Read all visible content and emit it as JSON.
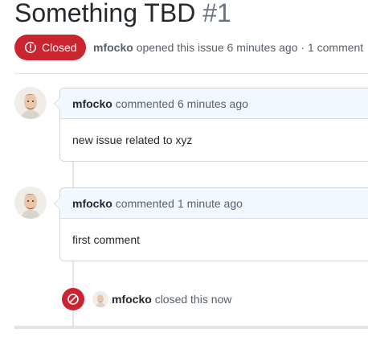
{
  "issue": {
    "title": "Something TBD",
    "number": "#1",
    "state_label": "Closed",
    "author": "mfocko",
    "opened_text": "opened this issue",
    "opened_time": "6 minutes ago",
    "separator": "·",
    "comment_count": "1 comment"
  },
  "comments": [
    {
      "author": "mfocko",
      "action": "commented",
      "time": "6 minutes ago",
      "body": "new issue related to xyz"
    },
    {
      "author": "mfocko",
      "action": "commented",
      "time": "1 minute ago",
      "body": "first comment"
    }
  ],
  "event": {
    "author": "mfocko",
    "text": "closed this now"
  },
  "colors": {
    "closed_red": "#cb2431",
    "header_blue": "#f1f8ff",
    "border": "#d1d5da",
    "muted": "#586069"
  },
  "icons": {
    "state": "issue-closed-icon",
    "event": "circle-slash-icon"
  }
}
